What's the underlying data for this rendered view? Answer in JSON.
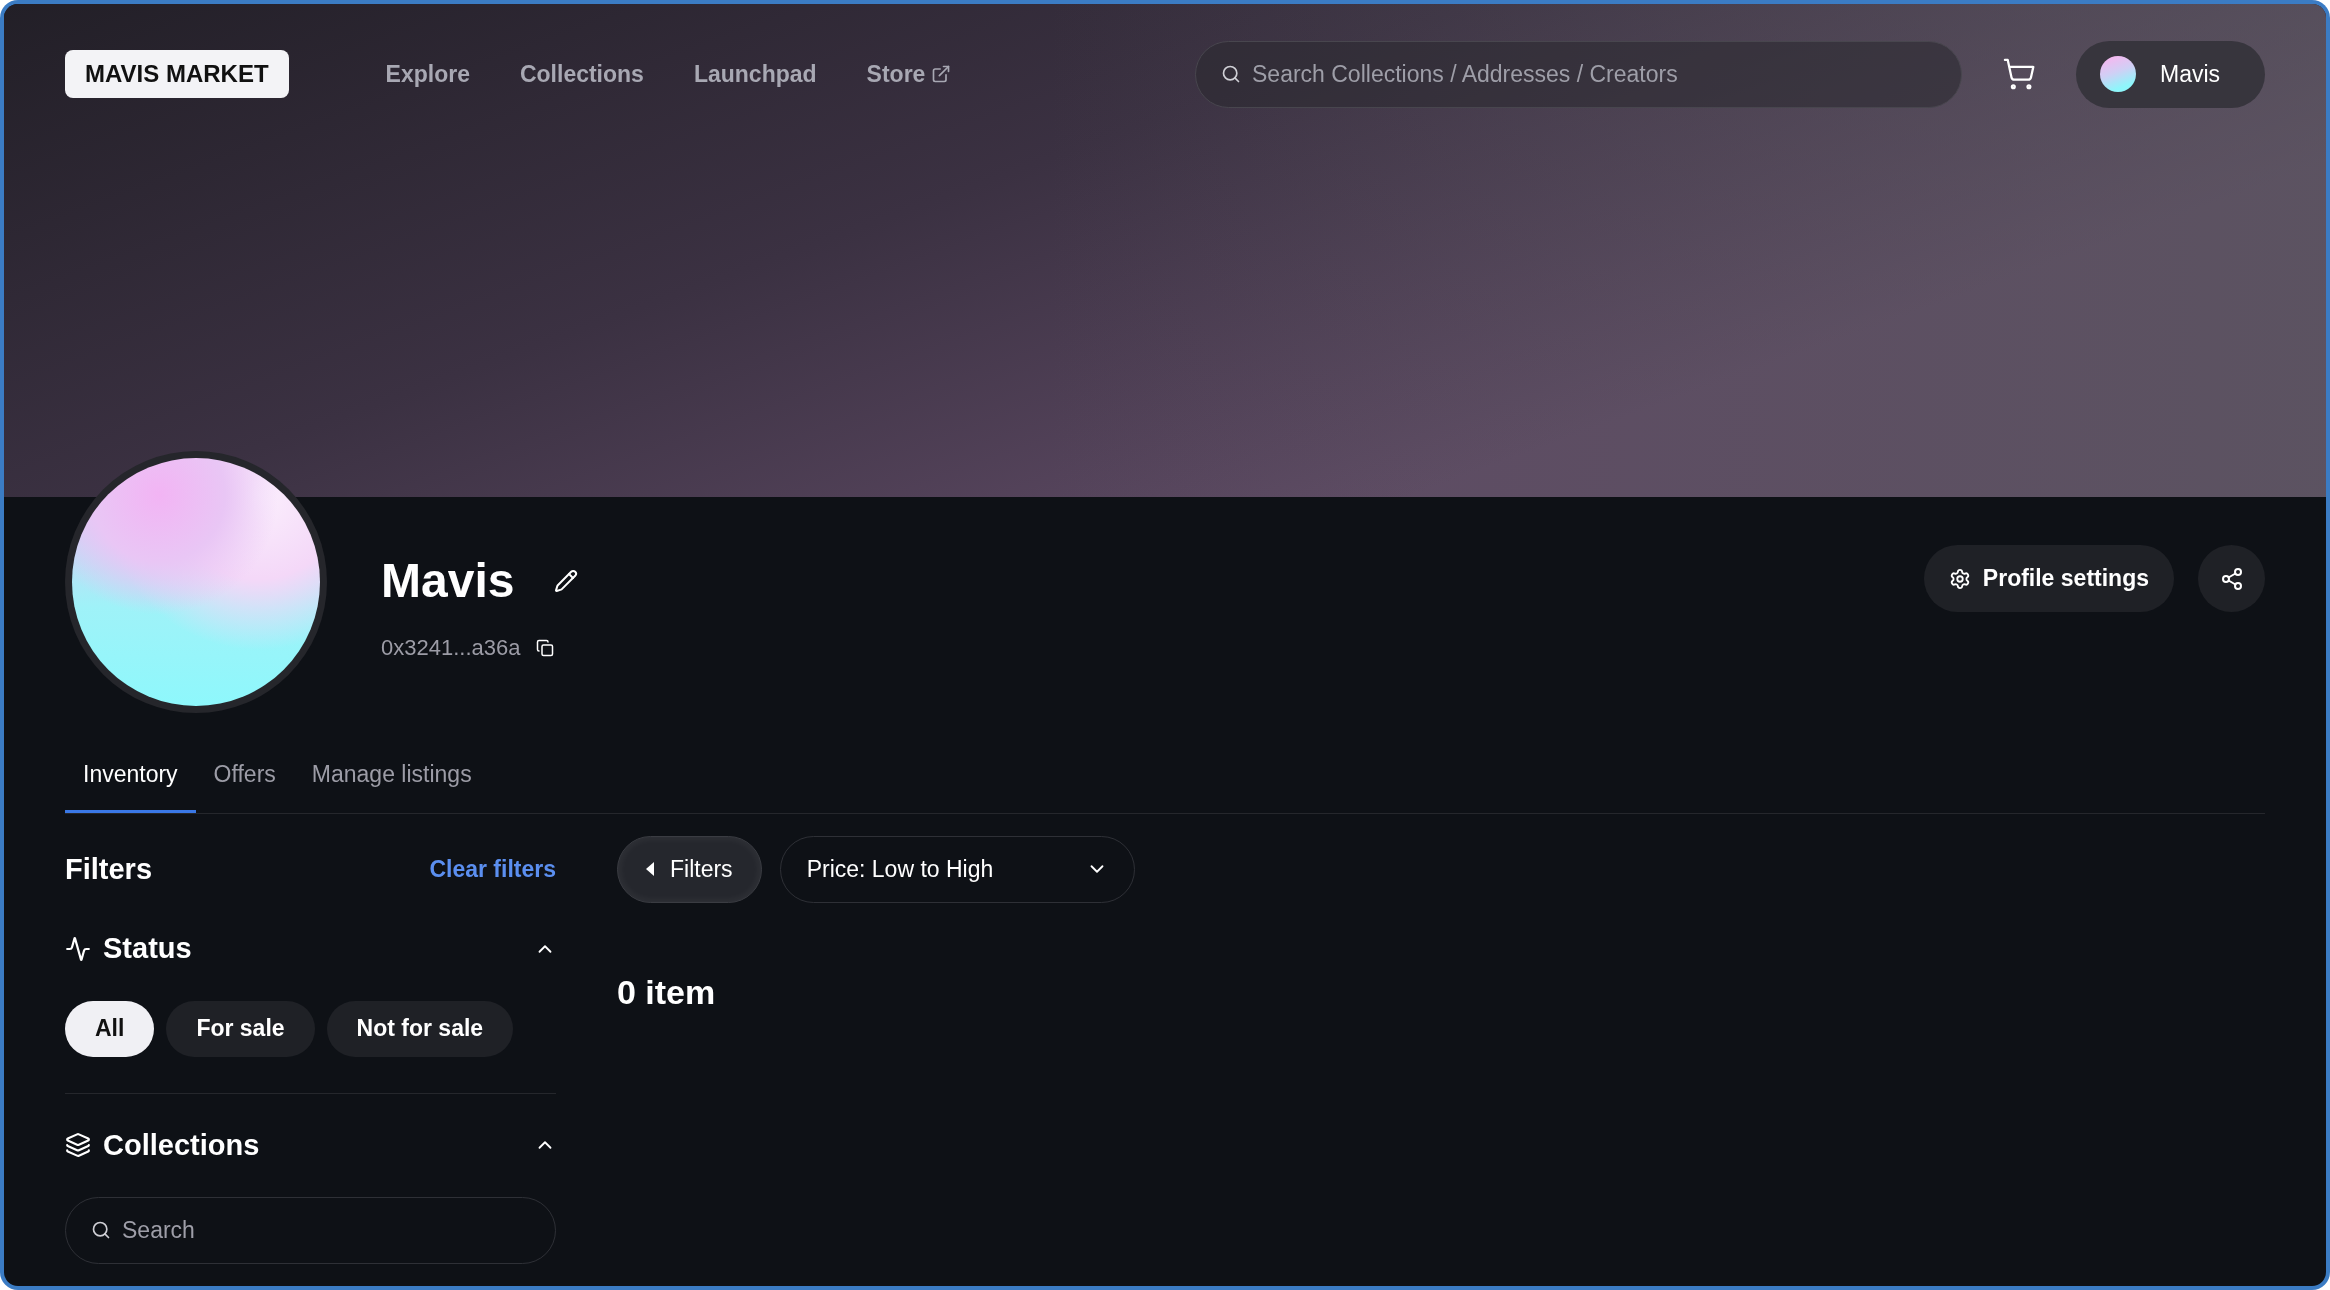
{
  "header": {
    "logo": "MAVIS MARKET",
    "nav": [
      {
        "label": "Explore",
        "external": false
      },
      {
        "label": "Collections",
        "external": false
      },
      {
        "label": "Launchpad",
        "external": false
      },
      {
        "label": "Store",
        "external": true
      }
    ],
    "search": {
      "placeholder": "Search Collections / Addresses / Creators"
    },
    "user": {
      "name": "Mavis"
    }
  },
  "profile": {
    "name": "Mavis",
    "address": "0x3241...a36a",
    "settings_button": "Profile settings"
  },
  "tabs": [
    {
      "label": "Inventory",
      "selected": true
    },
    {
      "label": "Offers",
      "selected": false
    },
    {
      "label": "Manage listings",
      "selected": false
    }
  ],
  "filters": {
    "title": "Filters",
    "clear": "Clear filters",
    "sections": [
      {
        "kind": "status",
        "title": "Status",
        "expanded": true,
        "chips": [
          {
            "label": "All",
            "selected": true
          },
          {
            "label": "For sale",
            "selected": false
          },
          {
            "label": "Not for sale",
            "selected": false
          }
        ]
      },
      {
        "kind": "collections",
        "title": "Collections",
        "expanded": true,
        "search_placeholder": "Search"
      }
    ]
  },
  "toolbar": {
    "filters_button": "Filters",
    "sort": "Price: Low to High"
  },
  "item_count": "0 item"
}
